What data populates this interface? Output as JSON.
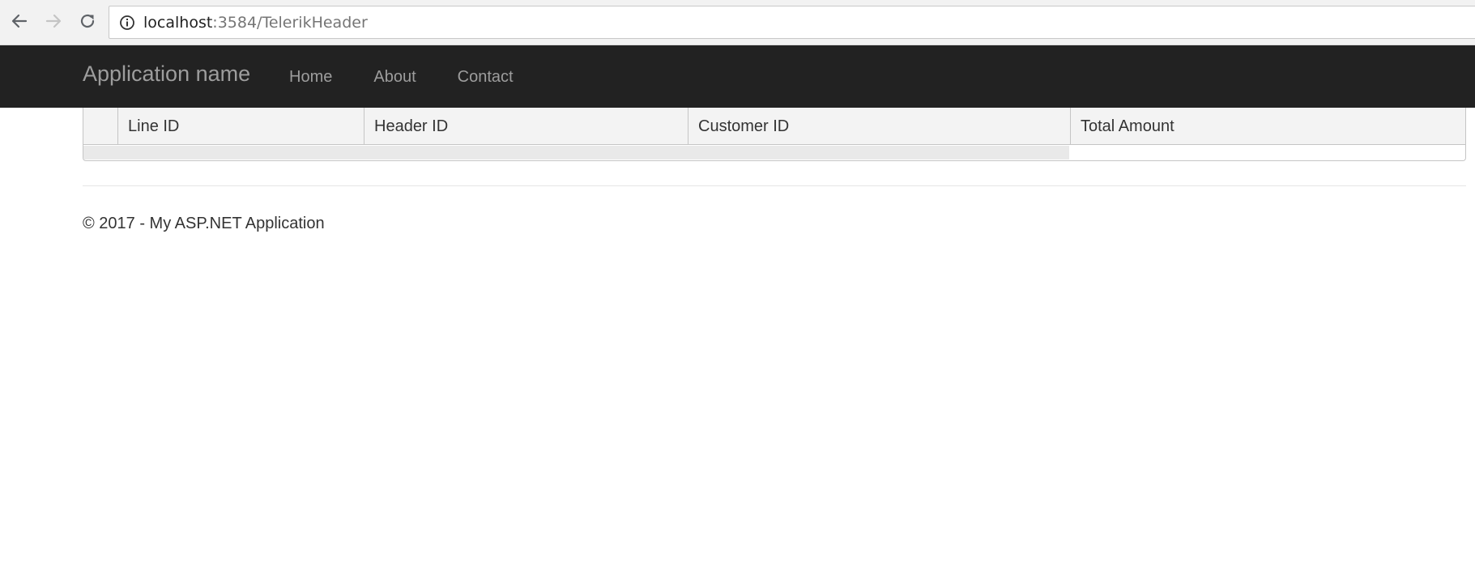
{
  "browser": {
    "url_host": "localhost",
    "url_path": ":3584/TelerikHeader",
    "icons": {
      "back": "arrow-left-icon",
      "forward": "arrow-right-icon",
      "reload": "reload-icon",
      "info": "info-icon"
    }
  },
  "navbar": {
    "brand": "Application name",
    "links": [
      "Home",
      "About",
      "Contact"
    ]
  },
  "grid": {
    "columns": [
      "Line ID",
      "Header ID",
      "Customer ID",
      "Total Amount"
    ]
  },
  "footer": {
    "text": "© 2017 - My ASP.NET Application"
  },
  "colors": {
    "navbar_bg": "#222222",
    "navbar_text": "#9d9d9d",
    "grid_header_bg": "#f3f3f3",
    "border": "#c5c5c5"
  }
}
